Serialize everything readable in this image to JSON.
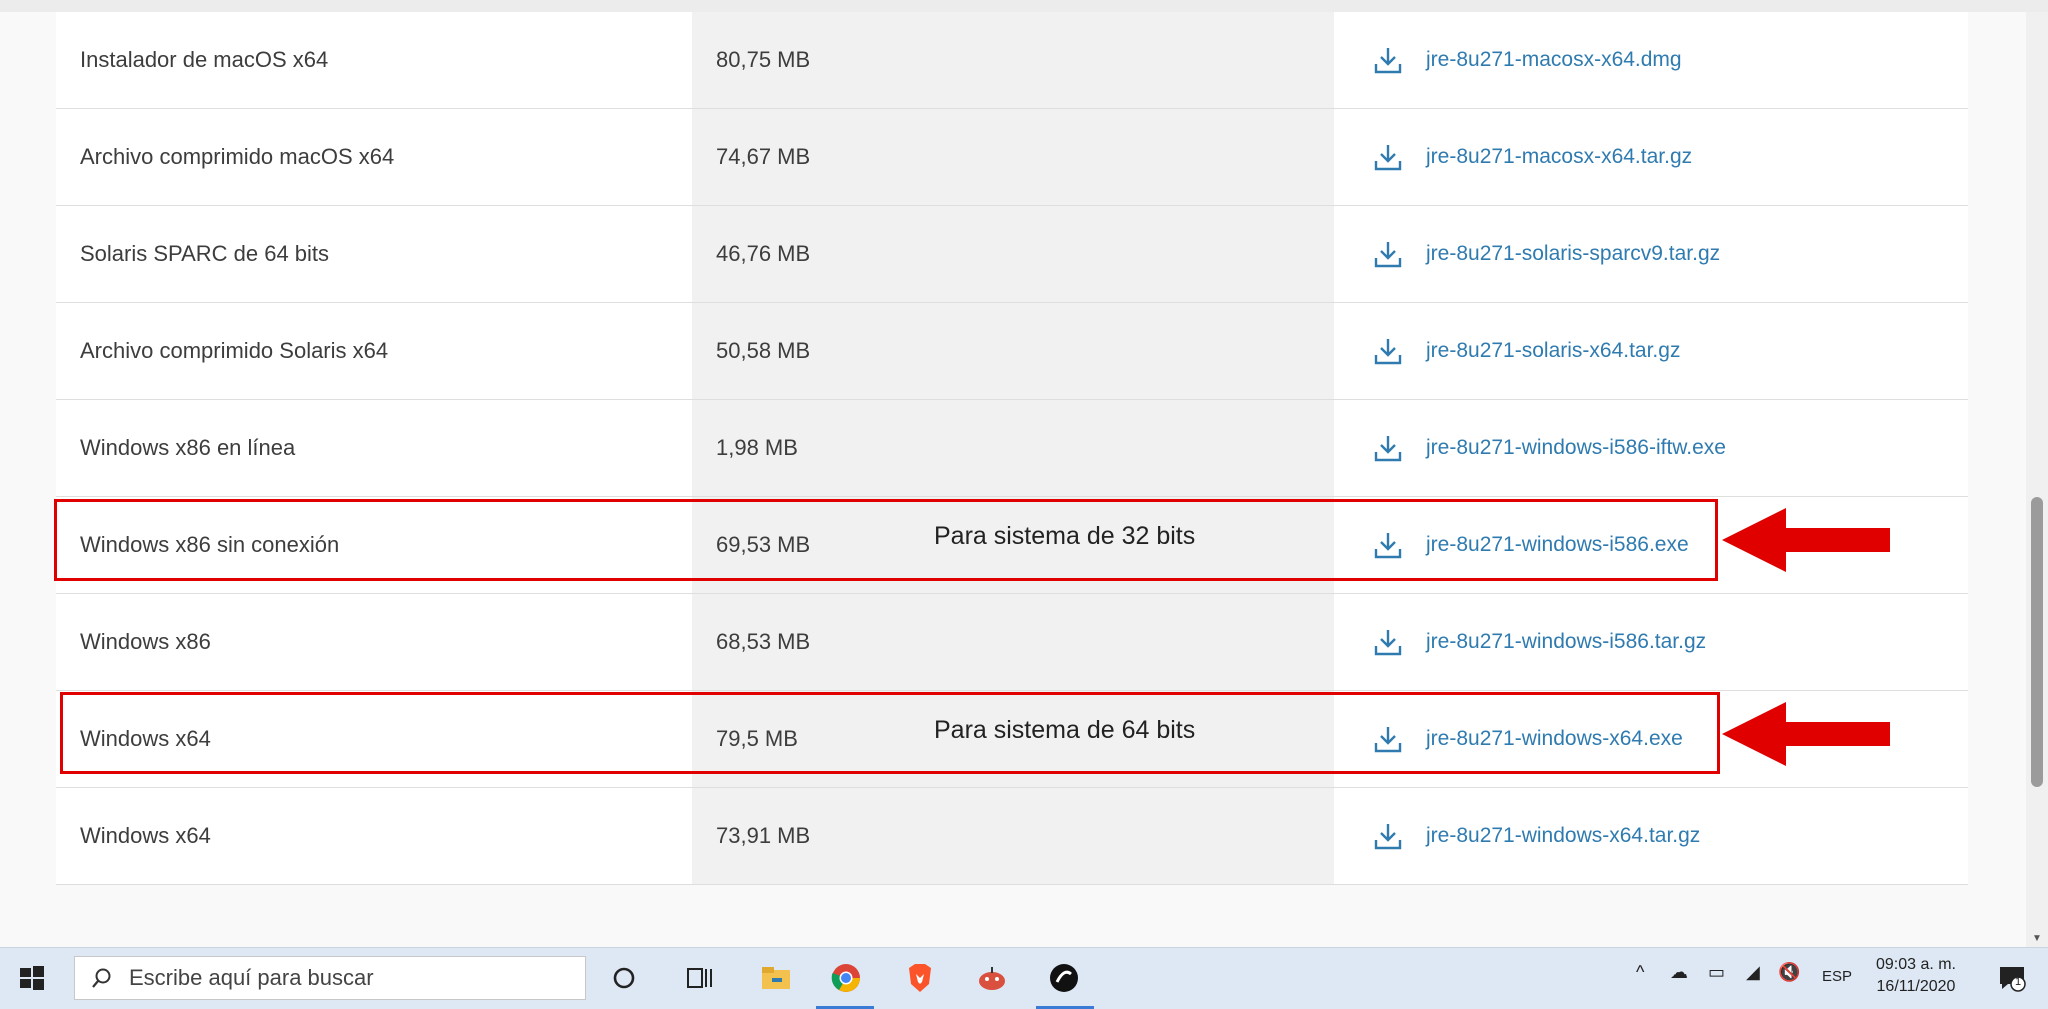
{
  "rows": [
    {
      "name": "Instalador de macOS x64",
      "size": "80,75 MB",
      "file": "jre-8u271-macosx-x64.dmg"
    },
    {
      "name": "Archivo comprimido macOS x64",
      "size": "74,67 MB",
      "file": "jre-8u271-macosx-x64.tar.gz"
    },
    {
      "name": "Solaris SPARC de 64 bits",
      "size": "46,76 MB",
      "file": "jre-8u271-solaris-sparcv9.tar.gz"
    },
    {
      "name": "Archivo comprimido Solaris x64",
      "size": "50,58 MB",
      "file": "jre-8u271-solaris-x64.tar.gz"
    },
    {
      "name": "Windows x86 en línea",
      "size": "1,98 MB",
      "file": "jre-8u271-windows-i586-iftw.exe"
    },
    {
      "name": "Windows x86 sin conexión",
      "size": "69,53 MB",
      "file": "jre-8u271-windows-i586.exe"
    },
    {
      "name": "Windows x86",
      "size": "68,53 MB",
      "file": "jre-8u271-windows-i586.tar.gz"
    },
    {
      "name": "Windows x64",
      "size": "79,5 MB",
      "file": "jre-8u271-windows-x64.exe"
    },
    {
      "name": "Windows x64",
      "size": "73,91 MB",
      "file": "jre-8u271-windows-x64.tar.gz"
    }
  ],
  "annotations": {
    "note_32": "Para sistema de 32 bits",
    "note_64": "Para sistema de 64 bits",
    "highlight_color": "#e00000"
  },
  "taskbar": {
    "search_placeholder": "Escribe aquí para buscar",
    "language": "ESP",
    "time": "09:03 a. m.",
    "date": "16/11/2020",
    "notification_count": "1"
  },
  "colors": {
    "link": "#2f7bb0",
    "accent": "#3a7bd5"
  }
}
